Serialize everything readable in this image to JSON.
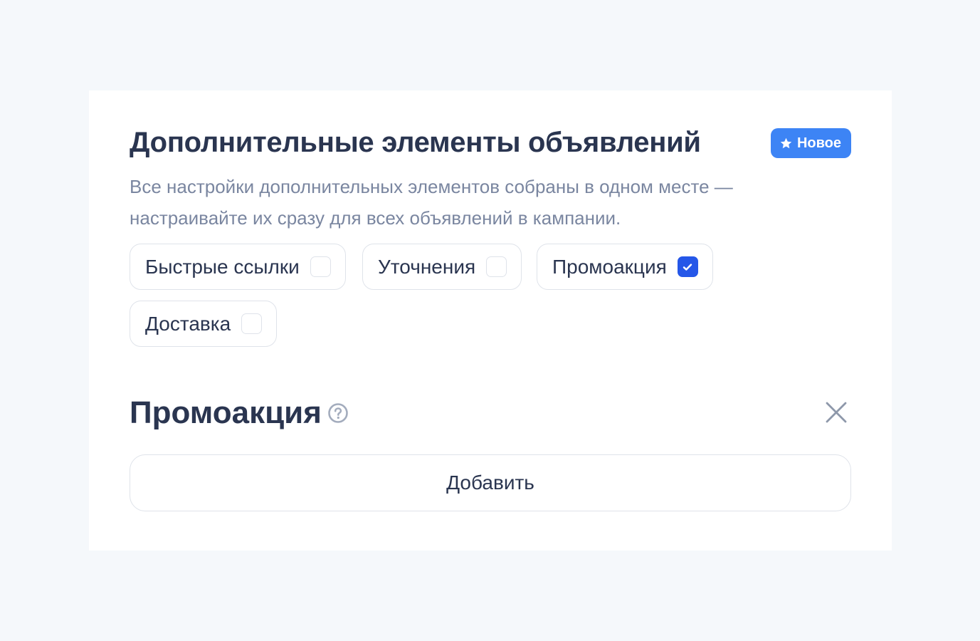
{
  "header": {
    "title": "Дополнительные элементы объявлений",
    "badge_label": "Новое",
    "badge_icon": "star-icon",
    "badge_color": "#3d84f5"
  },
  "description_line1": "Все настройки дополнительных элементов собраны в одном месте —",
  "description_line2": "настраивайте их сразу для всех объявлений в кампании.",
  "chips": [
    {
      "label": "Быстрые ссылки",
      "checked": false
    },
    {
      "label": "Уточнения",
      "checked": false
    },
    {
      "label": "Промоакция",
      "checked": true
    },
    {
      "label": "Доставка",
      "checked": false
    }
  ],
  "section": {
    "title": "Промоакция",
    "help_icon": "question-circle-icon",
    "close_icon": "close-icon",
    "add_button_label": "Добавить"
  },
  "colors": {
    "accent": "#2557e8",
    "text_primary": "#2a3550",
    "text_secondary": "#7a86a0",
    "background": "#f5f8fb"
  }
}
